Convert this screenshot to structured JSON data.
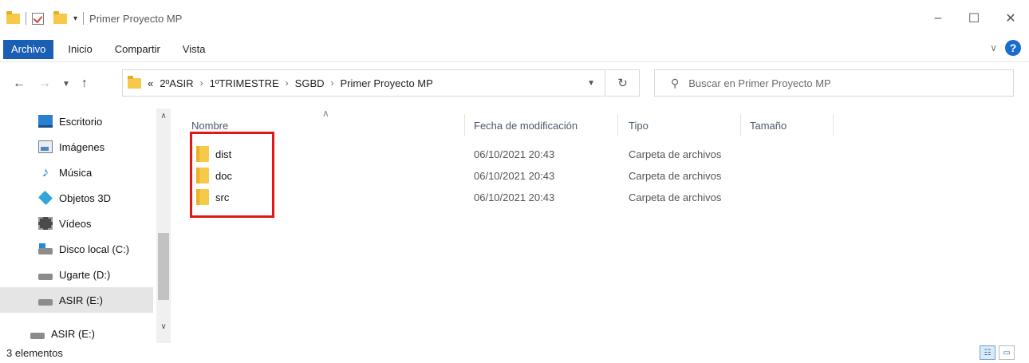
{
  "window": {
    "title": "Primer Proyecto MP",
    "controls": {
      "minimize": "–",
      "maximize": "☐",
      "close": "✕"
    }
  },
  "ribbon": {
    "tabs": [
      "Archivo",
      "Inicio",
      "Compartir",
      "Vista"
    ],
    "active_tab": "Archivo",
    "accent_color": "#1a5fb4"
  },
  "navigation": {
    "back": "←",
    "forward": "→",
    "recent": "▼",
    "up": "↑",
    "overflow": "«",
    "breadcrumbs": [
      "2ºASIR",
      "1ºTRIMESTRE",
      "SGBD",
      "Primer Proyecto MP"
    ],
    "search_placeholder": "Buscar en Primer Proyecto MP"
  },
  "sidebar": {
    "items": [
      {
        "label": "Escritorio",
        "icon": "desktop-icon"
      },
      {
        "label": "Imágenes",
        "icon": "pictures-icon"
      },
      {
        "label": "Música",
        "icon": "music-icon"
      },
      {
        "label": "Objetos 3D",
        "icon": "3d-objects-icon"
      },
      {
        "label": "Vídeos",
        "icon": "videos-icon"
      },
      {
        "label": "Disco local (C:)",
        "icon": "local-disk-icon"
      },
      {
        "label": "Ugarte  (D:)",
        "icon": "drive-icon"
      },
      {
        "label": "ASIR (E:)",
        "icon": "drive-icon",
        "selected": true
      },
      {
        "label": "ASIR (E:)",
        "icon": "drive-icon"
      }
    ]
  },
  "content": {
    "columns": [
      "Nombre",
      "Fecha de modificación",
      "Tipo",
      "Tamaño"
    ],
    "rows": [
      {
        "name": "dist",
        "date": "06/10/2021 20:43",
        "type": "Carpeta de archivos"
      },
      {
        "name": "doc",
        "date": "06/10/2021 20:43",
        "type": "Carpeta de archivos"
      },
      {
        "name": "src",
        "date": "06/10/2021 20:43",
        "type": "Carpeta de archivos"
      }
    ],
    "highlight_color": "#e01818"
  },
  "status": {
    "item_count": "3 elementos"
  }
}
